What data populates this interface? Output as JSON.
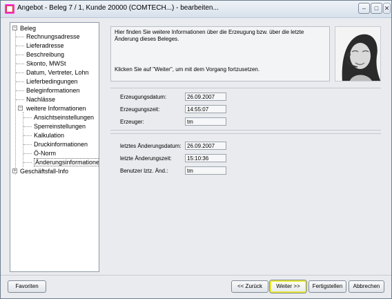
{
  "window": {
    "title": "Angebot - Beleg 7 / 1, Kunde 20000 (COMTECH...)  - bearbeiten...",
    "min_label": "–",
    "max_label": "□",
    "close_label": "✕"
  },
  "tree": {
    "root": "Beleg",
    "items": [
      "Rechnungsadresse",
      "Lieferadresse",
      "Beschreibung",
      "Skonto, MWSt",
      "Datum, Vertreter, Lohn",
      "Lieferbedingungen",
      "Beleginformationen",
      "Nachlässe"
    ],
    "sub_parent": "weitere Informationen",
    "sub_items": [
      "Ansichtseinstellungen",
      "Sperreinstellungen",
      "Kalkulation",
      "Druckinformationen",
      "Ö-Norm",
      "Änderungsinformationen"
    ],
    "last": "Geschäftsfall-Info"
  },
  "info": {
    "line1": "Hier finden Sie weitere Informationen über die Erzeugung bzw. über die letzte Änderung dieses Beleges.",
    "line2": "Klicken Sie auf \"Weiter\", um mit dem Vorgang fortzusetzen."
  },
  "fields": {
    "erzeugungsdatum_label": "Erzeugungsdatum:",
    "erzeugungsdatum_value": "26.09.2007",
    "erzeugungszeit_label": "Erzeugungszeit:",
    "erzeugungszeit_value": "14:55:07",
    "erzeuger_label": "Erzeuger:",
    "erzeuger_value": "tm",
    "aend_datum_label": "letztes Änderungsdatum:",
    "aend_datum_value": "26.09.2007",
    "aend_zeit_label": "letzte Änderungszeit:",
    "aend_zeit_value": "15:10:36",
    "aend_user_label": "Benutzer lztz. Änd.:",
    "aend_user_value": "tm"
  },
  "buttons": {
    "favoriten": "Favoriten",
    "zurueck": "<< Zurück",
    "weiter": "Weiter >>",
    "fertigstellen": "Fertigstellen",
    "abbrechen": "Abbrechen"
  },
  "colors": {
    "focus_border": "#e8e830",
    "window_bg": "#e9ebee"
  }
}
